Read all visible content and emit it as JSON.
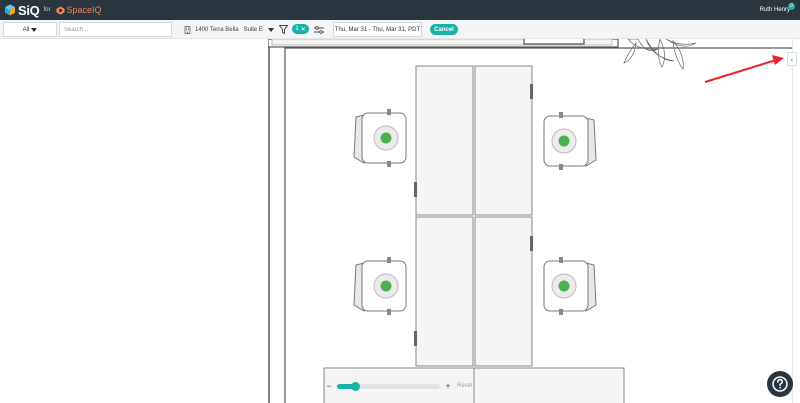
{
  "header": {
    "brand": "SiQ",
    "for_label": "for",
    "partner": "SpaceIQ",
    "user_name": "Ruth Henry",
    "notification_count": "0"
  },
  "filters": {
    "scope_label": "All",
    "search_placeholder": "Search...",
    "building": "1400 Terra Bella",
    "floor": "Suite E",
    "active_filter_count": "1",
    "date_range": "Thu, Mar 31 - Thu, Mar 31, PDT",
    "cancel_label": "Cancel"
  },
  "zoom": {
    "minus_label": "−",
    "plus_label": "+",
    "reset_label": "Reset",
    "level": 0.18
  },
  "colors": {
    "accent": "#18b3a8",
    "header_bg": "#2b353e",
    "available_seat": "#4cb050",
    "arrow": "#e8252b"
  },
  "icons": {
    "logo": "siq-cube-icon",
    "partner": "spaceiq-logo-icon",
    "building": "building-icon",
    "filter": "filter-icon",
    "adjust": "sliders-icon",
    "help": "question-icon",
    "collapse": "chevron-left-icon"
  }
}
